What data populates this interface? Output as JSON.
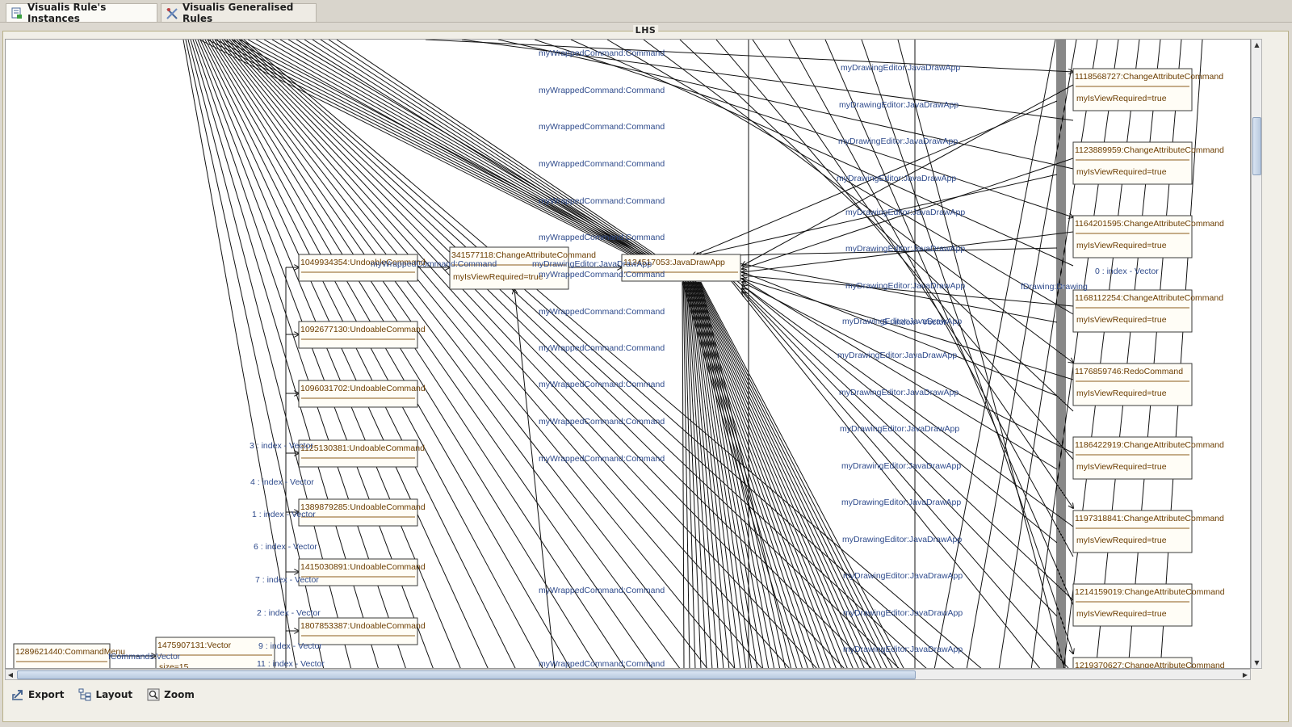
{
  "tabs": [
    {
      "label": "Visualis Rule's Instances",
      "icon": "instances-icon",
      "active": true
    },
    {
      "label": "Visualis Generalised Rules",
      "icon": "rules-icon",
      "active": false
    }
  ],
  "panel": {
    "title": "LHS"
  },
  "toolbar": {
    "export_label": "Export",
    "layout_label": "Layout",
    "zoom_label": "Zoom"
  },
  "diagram": {
    "nodes": {
      "n_cmdmenu": {
        "name": "1289621440:CommandMenu",
        "attr": ""
      },
      "n_vector": {
        "name": "1475907131:Vector",
        "attr": "size=15"
      },
      "n_u1": {
        "name": "1049934354:UndoableCommand",
        "attr": ""
      },
      "n_u2": {
        "name": "1092677130:UndoableCommand",
        "attr": ""
      },
      "n_u3": {
        "name": "1096031702:UndoableCommand",
        "attr": ""
      },
      "n_u4": {
        "name": "1125130381:UndoableCommand",
        "attr": ""
      },
      "n_u5": {
        "name": "1389879285:UndoableCommand",
        "attr": ""
      },
      "n_u6": {
        "name": "1415030891:UndoableCommand",
        "attr": ""
      },
      "n_u7": {
        "name": "1807853387:UndoableCommand",
        "attr": ""
      },
      "n_cac_mid": {
        "name": "341577118:ChangeAttributeCommand",
        "attr": "myIsViewRequired=true"
      },
      "n_app": {
        "name": "1134517053:JavaDrawApp",
        "attr": ""
      },
      "n_r1": {
        "name": "1118568727:ChangeAttributeCommand",
        "attr": "myIsViewRequired=true"
      },
      "n_r2": {
        "name": "1123889959:ChangeAttributeCommand",
        "attr": "myIsViewRequired=true"
      },
      "n_r3": {
        "name": "1164201595:ChangeAttributeCommand",
        "attr": "myIsViewRequired=true"
      },
      "n_r4": {
        "name": "1168112254:ChangeAttributeCommand",
        "attr": "myIsViewRequired=true"
      },
      "n_r5": {
        "name": "1176859746:RedoCommand",
        "attr": "myIsViewRequired=true"
      },
      "n_r6": {
        "name": "1186422919:ChangeAttributeCommand",
        "attr": "myIsViewRequired=true"
      },
      "n_r7": {
        "name": "1197318841:ChangeAttributeCommand",
        "attr": "myIsViewRequired=true"
      },
      "n_r8": {
        "name": "1214159019:ChangeAttributeCommand",
        "attr": "myIsViewRequired=true"
      },
      "n_r9": {
        "name": "1219370627:ChangeAttributeCommand",
        "attr": ""
      }
    },
    "labels": {
      "wrapped": "myWrappedCommand:Command",
      "editor": "myDrawingEditor:JavaDrawApp",
      "fcommands": "fCommands:Vector",
      "fdrawing": "fDrawing:Drawing",
      "idx0": "0 : index - Vector",
      "idx1": "1 : index - Vector",
      "idx2": "2 : index - Vector",
      "idx3": "3 : index - Vector",
      "idx4": "4 : index - Vector",
      "idx6": "6 : index - Vector",
      "idx7": "7 : index - Vector",
      "idx9": "9 : index - Vector",
      "idx11": "11 : index - Vector",
      "idx_overlap": "5 : index - Vector"
    }
  },
  "colors": {
    "node_text": "#6b3d00",
    "edge_label": "#2f4b8c",
    "node_fill": "#fffdf6"
  }
}
